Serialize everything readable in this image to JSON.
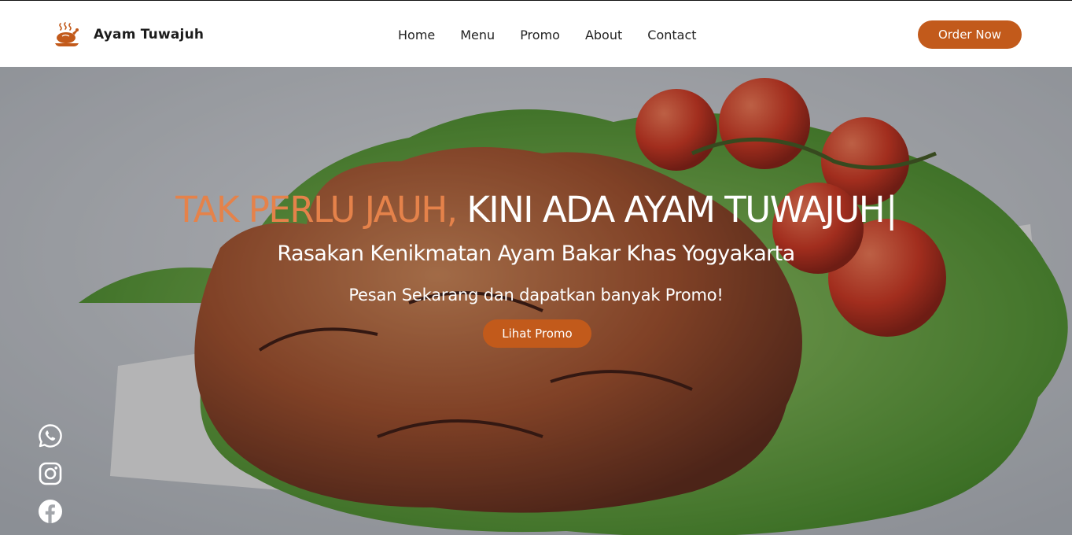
{
  "brand": {
    "name": "Ayam Tuwajuh",
    "logo_icon": "roast-chicken-icon",
    "accent_color": "#c25a1b"
  },
  "nav": {
    "items": [
      {
        "label": "Home"
      },
      {
        "label": "Menu"
      },
      {
        "label": "Promo"
      },
      {
        "label": "About"
      },
      {
        "label": "Contact"
      }
    ],
    "order_button": "Order Now"
  },
  "hero": {
    "title_accent": "TAK PERLU JAUH,",
    "title_main": "KINI ADA AYAM TUWAJUH",
    "title_cursor": "|",
    "subtitle": "Rasakan Kenikmatan Ayam Bakar Khas Yogyakarta",
    "tagline": "Pesan Sekarang dan dapatkan banyak Promo!",
    "button": "Lihat Promo",
    "background": "grilled-chicken-wings-with-lettuce-and-tomatoes-photo",
    "accent_text_color": "#e5824a"
  },
  "social": [
    {
      "icon": "whatsapp-icon"
    },
    {
      "icon": "instagram-icon"
    },
    {
      "icon": "facebook-icon"
    }
  ]
}
